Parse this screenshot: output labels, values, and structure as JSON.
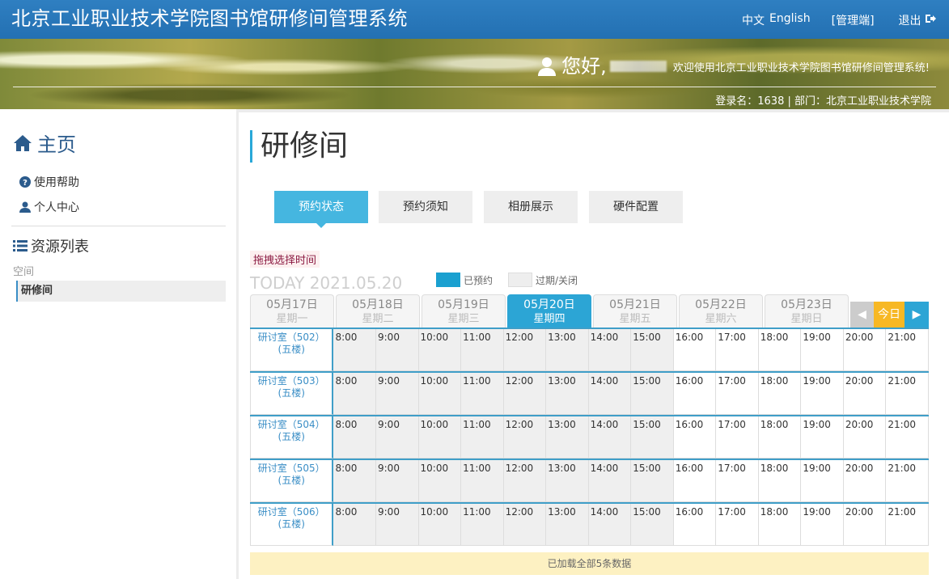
{
  "header": {
    "title": "北京工业职业技术学院图书馆研修间管理系统",
    "lang_cn": "中文",
    "lang_en": "English",
    "admin": "[管理端]",
    "logout": "退出"
  },
  "banner": {
    "hello": "您好,",
    "welcome": "欢迎使用北京工业职业技术学院图书馆研修间管理系统!",
    "login_info": "登录名：1638 | 部门：北京工业职业技术学院"
  },
  "sidebar": {
    "home": "主页",
    "help": "使用帮助",
    "personal": "个人中心",
    "resources": "资源列表",
    "space_label": "空间",
    "room_item": "研修间"
  },
  "main": {
    "title": "研修间",
    "tabs": [
      "预约状态",
      "预约须知",
      "相册展示",
      "硬件配置"
    ],
    "drag_hint": "拖拽选择时间",
    "today": "TODAY 2021.05.20",
    "legend_booked": "已预约",
    "legend_expired": "过期/关闭",
    "days": [
      {
        "date": "05月17日",
        "weekday": "星期一"
      },
      {
        "date": "05月18日",
        "weekday": "星期二"
      },
      {
        "date": "05月19日",
        "weekday": "星期三"
      },
      {
        "date": "05月20日",
        "weekday": "星期四"
      },
      {
        "date": "05月21日",
        "weekday": "星期五"
      },
      {
        "date": "05月22日",
        "weekday": "星期六"
      },
      {
        "date": "05月23日",
        "weekday": "星期日"
      }
    ],
    "nav_prev": "◀",
    "nav_today": "今日",
    "nav_next": "▶",
    "rooms": [
      {
        "name": "研讨室（502）",
        "floor": "(五楼)"
      },
      {
        "name": "研讨室（503）",
        "floor": "(五楼)"
      },
      {
        "name": "研讨室（504）",
        "floor": "(五楼)"
      },
      {
        "name": "研讨室（505）",
        "floor": "(五楼)"
      },
      {
        "name": "研讨室（506）",
        "floor": "(五楼)"
      }
    ],
    "times": [
      "8:00",
      "9:00",
      "10:00",
      "11:00",
      "12:00",
      "13:00",
      "14:00",
      "15:00",
      "16:00",
      "17:00",
      "18:00",
      "19:00",
      "20:00",
      "21:00"
    ],
    "expired_slot_count": 8,
    "footer": "已加载全部5条数据"
  }
}
